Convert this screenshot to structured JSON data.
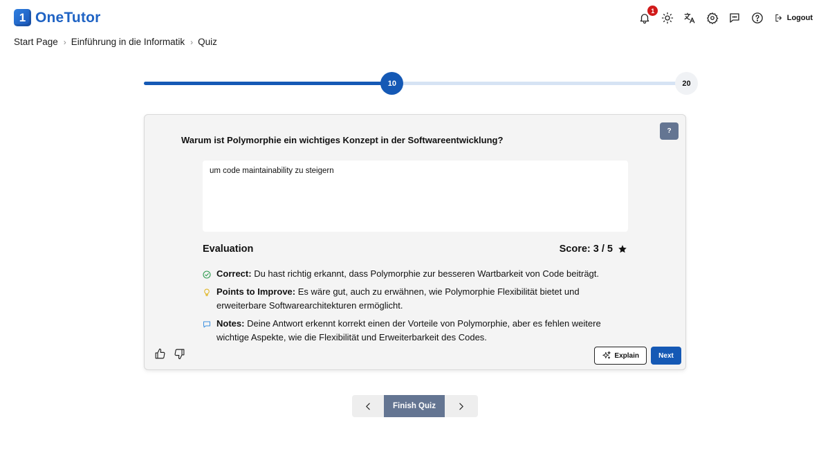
{
  "app": {
    "logo_mark": "1",
    "name": "OneTutor"
  },
  "header": {
    "notification_count": "1",
    "logout_label": "Logout",
    "icons": [
      "bell-icon",
      "sun-icon",
      "translate-icon",
      "gear-icon",
      "chat-icon",
      "help-icon",
      "logout-icon"
    ]
  },
  "breadcrumb": {
    "items": [
      "Start Page",
      "Einführung in die Informatik",
      "Quiz"
    ],
    "separator": ">"
  },
  "progress": {
    "current": "10",
    "total": "20",
    "fraction": 0.5
  },
  "question": {
    "help_label": "?",
    "text": "Warum ist Polymorphie ein wichtiges Konzept in der Softwareentwicklung?",
    "answer": "um code maintainability zu steigern"
  },
  "evaluation": {
    "title": "Evaluation",
    "score": "Score: 3 / 5",
    "items": [
      {
        "label": "Correct:",
        "text": "Du hast richtig erkannt, dass Polymorphie zur besseren Wartbarkeit von Code beiträgt.",
        "icon": "check-circle-icon",
        "color": "#2e9b4f"
      },
      {
        "label": "Points to Improve:",
        "text": "Es wäre gut, auch zu erwähnen, wie Polymorphie Flexibilität bietet und erweiterbare Softwarearchitekturen ermöglicht.",
        "icon": "lightbulb-icon",
        "color": "#e0b31c"
      },
      {
        "label": "Notes:",
        "text": "Deine Antwort erkennt korrekt einen der Vorteile von Polymorphie, aber es fehlen weitere wichtige Aspekte, wie die Flexibilität und Erweiterbarkeit des Codes.",
        "icon": "comment-icon",
        "color": "#3b8fe0"
      }
    ]
  },
  "actions": {
    "explain_label": "Explain",
    "next_label": "Next"
  },
  "pager": {
    "finish_label": "Finish Quiz"
  },
  "colors": {
    "primary": "#1559b5",
    "slate": "#647592",
    "badge": "#d11a1a"
  }
}
